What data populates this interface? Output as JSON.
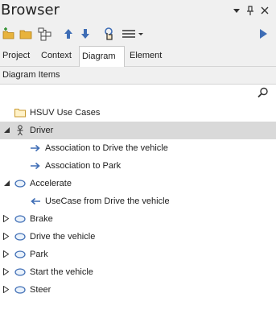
{
  "window": {
    "title": "Browser",
    "controls": [
      "dropdown-icon",
      "pin-icon",
      "close-icon"
    ]
  },
  "toolbar": {
    "buttons": [
      "new-package-icon",
      "open-folder-icon",
      "hierarchy-icon",
      "move-up-icon",
      "move-down-icon",
      "locate-icon",
      "menu-icon",
      "play-icon"
    ]
  },
  "tabs": [
    {
      "label": "Project",
      "active": false
    },
    {
      "label": "Context",
      "active": false
    },
    {
      "label": "Diagram",
      "active": true
    },
    {
      "label": "Element",
      "active": false
    }
  ],
  "section": {
    "title": "Diagram Items"
  },
  "tree": {
    "items": [
      {
        "label": "HSUV Use Cases",
        "icon": "folder-icon",
        "expander": "none",
        "selected": false
      },
      {
        "label": "Driver",
        "icon": "actor-icon",
        "expander": "expanded",
        "selected": true
      },
      {
        "label": "Association to Drive the vehicle",
        "icon": "arrow-right-icon",
        "expander": "none",
        "selected": false
      },
      {
        "label": "Association to Park",
        "icon": "arrow-right-icon",
        "expander": "none",
        "selected": false
      },
      {
        "label": "Accelerate",
        "icon": "usecase-icon",
        "expander": "expanded",
        "selected": false
      },
      {
        "label": "UseCase from Drive the vehicle",
        "icon": "arrow-left-icon",
        "expander": "none",
        "selected": false
      },
      {
        "label": "Brake",
        "icon": "usecase-icon",
        "expander": "collapsed",
        "selected": false
      },
      {
        "label": "Drive the vehicle",
        "icon": "usecase-icon",
        "expander": "collapsed",
        "selected": false
      },
      {
        "label": "Park",
        "icon": "usecase-icon",
        "expander": "collapsed",
        "selected": false
      },
      {
        "label": "Start the vehicle",
        "icon": "usecase-icon",
        "expander": "collapsed",
        "selected": false
      },
      {
        "label": "Steer",
        "icon": "usecase-icon",
        "expander": "collapsed",
        "selected": false
      }
    ]
  },
  "colors": {
    "accent": "#3e6db5",
    "folder": "#e8b33c",
    "selection": "#d9d9d9",
    "chrome": "#f0f0f0"
  }
}
